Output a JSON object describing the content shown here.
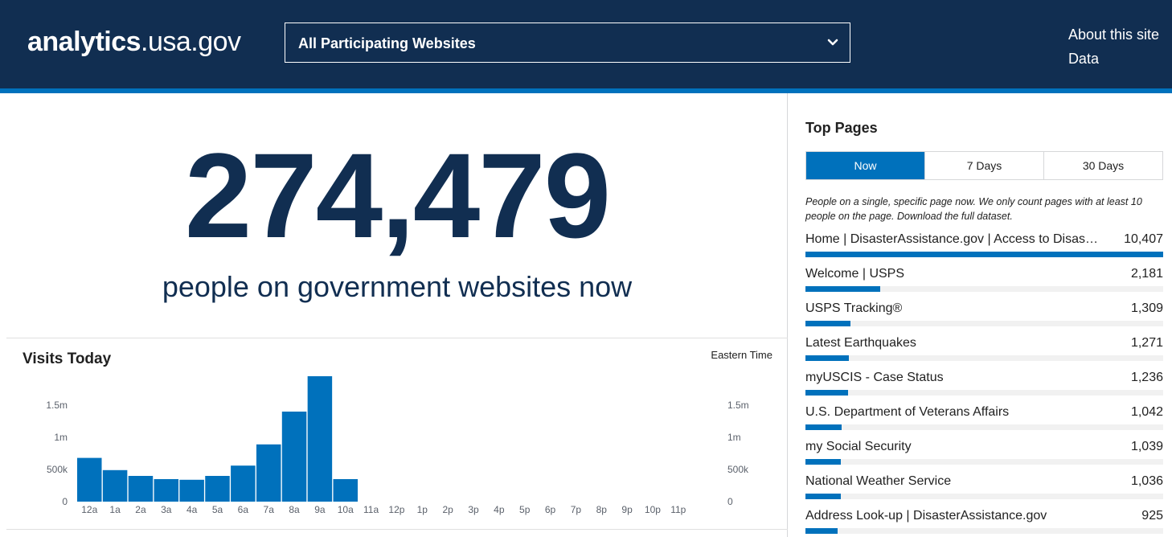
{
  "header": {
    "brand_bold": "analytics",
    "brand_light": ".usa.gov",
    "agency_select_value": "All Participating Websites",
    "nav": [
      "About this site",
      "Data"
    ]
  },
  "realtime": {
    "count": "274,479",
    "caption": "people on government websites now"
  },
  "visits": {
    "title": "Visits Today",
    "timezone": "Eastern Time"
  },
  "top_pages": {
    "title": "Top Pages",
    "tabs": [
      "Now",
      "7 Days",
      "30 Days"
    ],
    "active_tab": "Now",
    "description": "People on a single, specific page now. We only count pages with at least 10 people on the page. Download the full dataset.",
    "items": [
      {
        "name": "Home | DisasterAssistance.gov | Access to Disast…",
        "count": "10,407",
        "value": 10407
      },
      {
        "name": "Welcome | USPS",
        "count": "2,181",
        "value": 2181
      },
      {
        "name": "USPS Tracking®",
        "count": "1,309",
        "value": 1309
      },
      {
        "name": "Latest Earthquakes",
        "count": "1,271",
        "value": 1271
      },
      {
        "name": "myUSCIS - Case Status",
        "count": "1,236",
        "value": 1236
      },
      {
        "name": "U.S. Department of Veterans Affairs",
        "count": "1,042",
        "value": 1042
      },
      {
        "name": "my Social Security",
        "count": "1,039",
        "value": 1039
      },
      {
        "name": "National Weather Service",
        "count": "1,036",
        "value": 1036
      },
      {
        "name": "Address Look-up | DisasterAssistance.gov",
        "count": "925",
        "value": 925
      }
    ]
  },
  "colors": {
    "header_bg": "#112e51",
    "accent": "#0071bc"
  },
  "chart_data": {
    "type": "bar",
    "title": "Visits Today",
    "categories": [
      "12a",
      "1a",
      "2a",
      "3a",
      "4a",
      "5a",
      "6a",
      "7a",
      "8a",
      "9a",
      "10a",
      "11a",
      "12p",
      "1p",
      "2p",
      "3p",
      "4p",
      "5p",
      "6p",
      "7p",
      "8p",
      "9p",
      "10p",
      "11p"
    ],
    "values": [
      680000,
      490000,
      400000,
      350000,
      340000,
      400000,
      560000,
      890000,
      1400000,
      1950000,
      350000,
      null,
      null,
      null,
      null,
      null,
      null,
      null,
      null,
      null,
      null,
      null,
      null,
      null
    ],
    "yticks": [
      0,
      500000,
      1000000,
      1500000
    ],
    "ytick_labels": [
      "0",
      "500k",
      "1m",
      "1.5m"
    ],
    "ylim": [
      0,
      1950000
    ],
    "grid": false,
    "y_axis": "both sides"
  }
}
